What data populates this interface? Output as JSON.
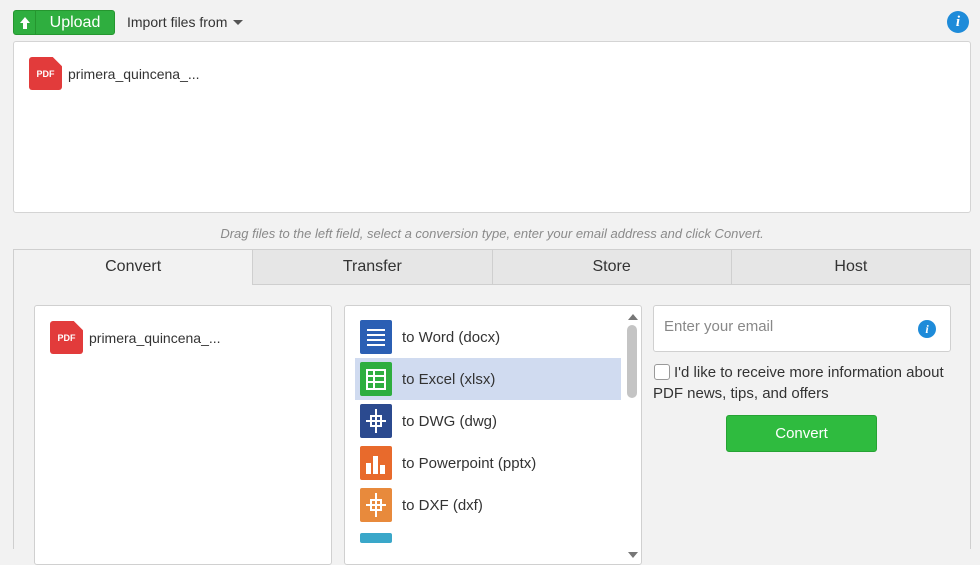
{
  "topbar": {
    "upload_label": "Upload",
    "import_label": "Import files from",
    "info_icon": "i"
  },
  "dropzone": {
    "files": [
      {
        "icon": "pdf-file-icon",
        "icon_text": "PDF",
        "name": "primera_quincena_..."
      }
    ]
  },
  "hint": "Drag files to the left field, select a conversion type, enter your email address and click Convert.",
  "tabs": [
    {
      "label": "Convert",
      "active": true
    },
    {
      "label": "Transfer"
    },
    {
      "label": "Store"
    },
    {
      "label": "Host"
    }
  ],
  "convert": {
    "files": [
      {
        "icon": "pdf-file-icon",
        "icon_text": "PDF",
        "name": "primera_quincena_..."
      }
    ],
    "types": [
      {
        "label": "to Word (docx)",
        "icon": "word-doc-icon",
        "color": "#2b5fb4"
      },
      {
        "label": "to Excel (xlsx)",
        "icon": "excel-sheet-icon",
        "color": "#2eae3f",
        "selected": true
      },
      {
        "label": "to DWG (dwg)",
        "icon": "dwg-cad-icon",
        "color": "#2b4a8f"
      },
      {
        "label": "to Powerpoint (pptx)",
        "icon": "powerpoint-chart-icon",
        "color": "#e86a2c"
      },
      {
        "label": "to DXF (dxf)",
        "icon": "dxf-cad-icon",
        "color": "#e88a3c"
      }
    ],
    "email_placeholder": "Enter your email",
    "email_info_icon": "i",
    "optin_text": "I'd like to receive more information about PDF news, tips, and offers",
    "convert_label": "Convert"
  },
  "colors": {
    "accent_green": "#2fae3f",
    "info_blue": "#1e8bd9",
    "pdf_red": "#e23b3b",
    "selected_row": "#d0dbf0"
  }
}
